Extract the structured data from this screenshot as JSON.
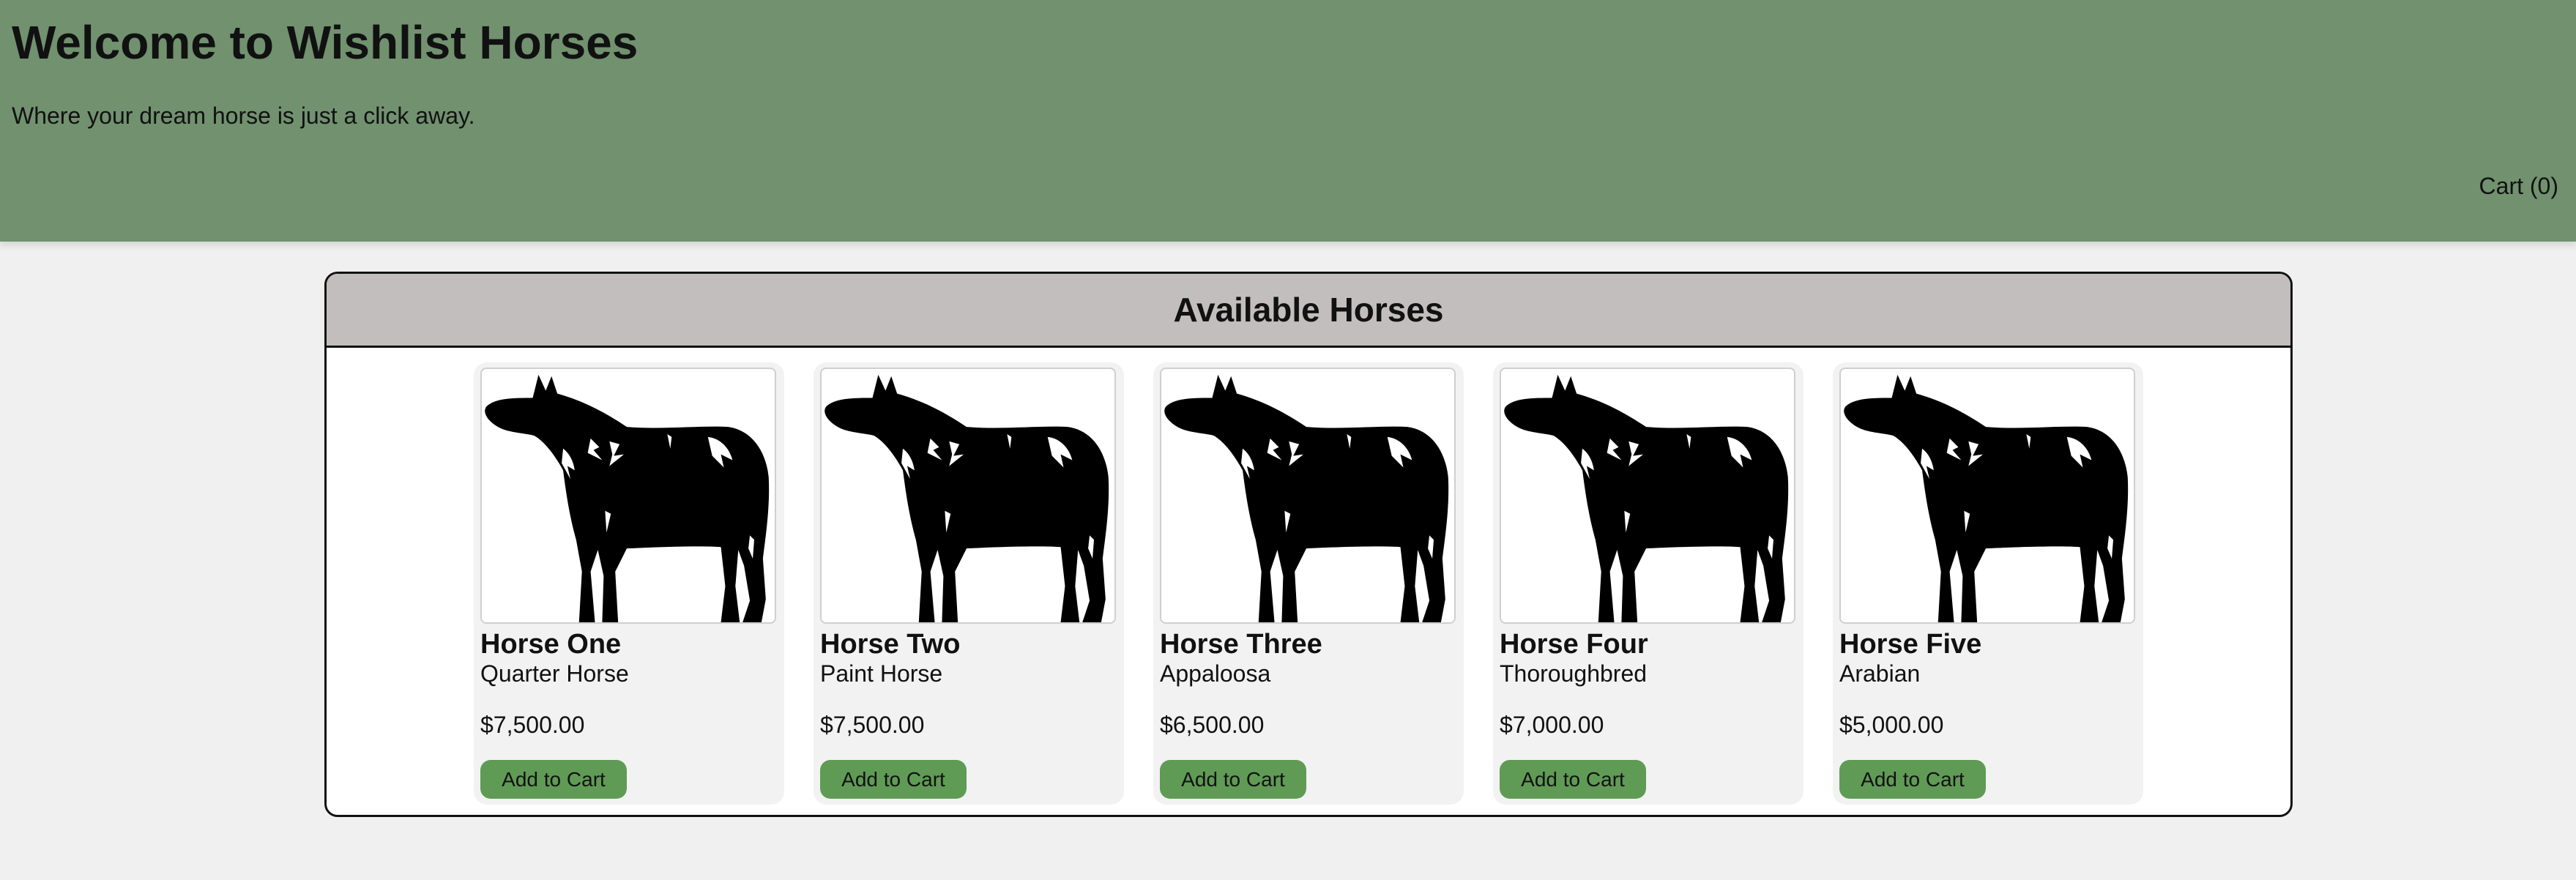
{
  "header": {
    "title": "Welcome to Wishlist Horses",
    "tagline": "Where your dream horse is just a click away.",
    "cart_label": "Cart (0)"
  },
  "section": {
    "title": "Available Horses"
  },
  "horses": [
    {
      "name": "Horse One",
      "breed": "Quarter Horse",
      "price": "$7,500.00",
      "button": "Add to Cart",
      "icon": "horse-silhouette-icon"
    },
    {
      "name": "Horse Two",
      "breed": "Paint Horse",
      "price": "$7,500.00",
      "button": "Add to Cart",
      "icon": "horse-silhouette-icon"
    },
    {
      "name": "Horse Three",
      "breed": "Appaloosa",
      "price": "$6,500.00",
      "button": "Add to Cart",
      "icon": "horse-silhouette-icon"
    },
    {
      "name": "Horse Four",
      "breed": "Thoroughbred",
      "price": "$7,000.00",
      "button": "Add to Cart",
      "icon": "horse-silhouette-icon"
    },
    {
      "name": "Horse Five",
      "breed": "Arabian",
      "price": "$5,000.00",
      "button": "Add to Cart",
      "icon": "horse-silhouette-icon"
    }
  ],
  "colors": {
    "header_bg": "#71916f",
    "panel_header_bg": "#c2bebd",
    "button_bg": "#5f9b55",
    "card_bg": "#f2f2f2"
  }
}
